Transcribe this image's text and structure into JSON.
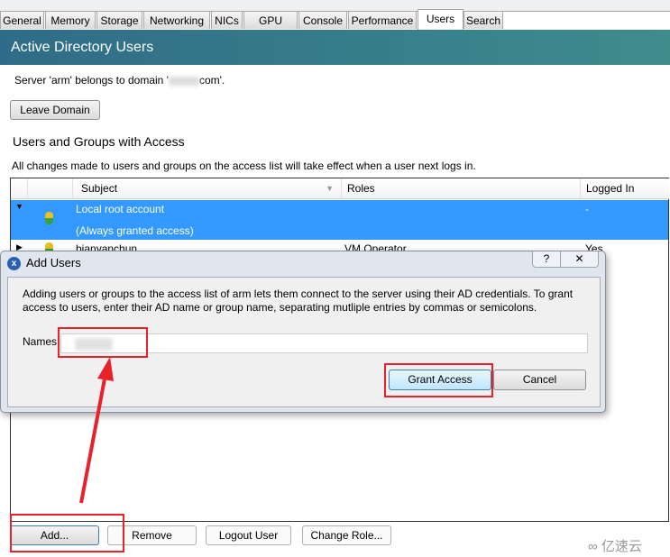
{
  "tabs": [
    "General",
    "Memory",
    "Storage",
    "Networking",
    "NICs",
    "GPU",
    "Console",
    "Performance",
    "Users",
    "Search"
  ],
  "active_tab": "Users",
  "header": {
    "title": "Active Directory Users"
  },
  "domain_text": "Server 'arm' belongs to domain '",
  "domain_suffix": "com'.",
  "leave_domain": "Leave Domain",
  "section_title": "Users and Groups with Access",
  "note": "All changes made to users and groups on the access list will take effect when a user next logs in.",
  "table": {
    "columns": [
      "Subject",
      "Roles",
      "Logged In"
    ],
    "rows": [
      {
        "subject": "Local root account",
        "subtitle": "(Always granted access)",
        "roles": "",
        "logged_in": "-",
        "selected": true,
        "expanded": true
      },
      {
        "subject": "bianyanchun",
        "roles": "VM Operator",
        "logged_in": "Yes",
        "selected": false,
        "expanded": false
      }
    ]
  },
  "dialog": {
    "title": "Add Users",
    "help": "?",
    "close": "✕",
    "description": "Adding users or groups to the access list of arm lets them connect to the server using their AD credentials. To grant access to users, enter their AD name or group name, separating mutliple entries by commas or semicolons.",
    "names_label": "Names:",
    "names_value": "",
    "grant": "Grant Access",
    "cancel": "Cancel"
  },
  "buttons": {
    "add": "Add...",
    "remove": "Remove",
    "logout": "Logout User",
    "change_role": "Change Role..."
  },
  "watermark": "亿速云",
  "colors": {
    "header": "#2f6c87",
    "selected": "#3399ff",
    "annotation": "#e8222a"
  }
}
